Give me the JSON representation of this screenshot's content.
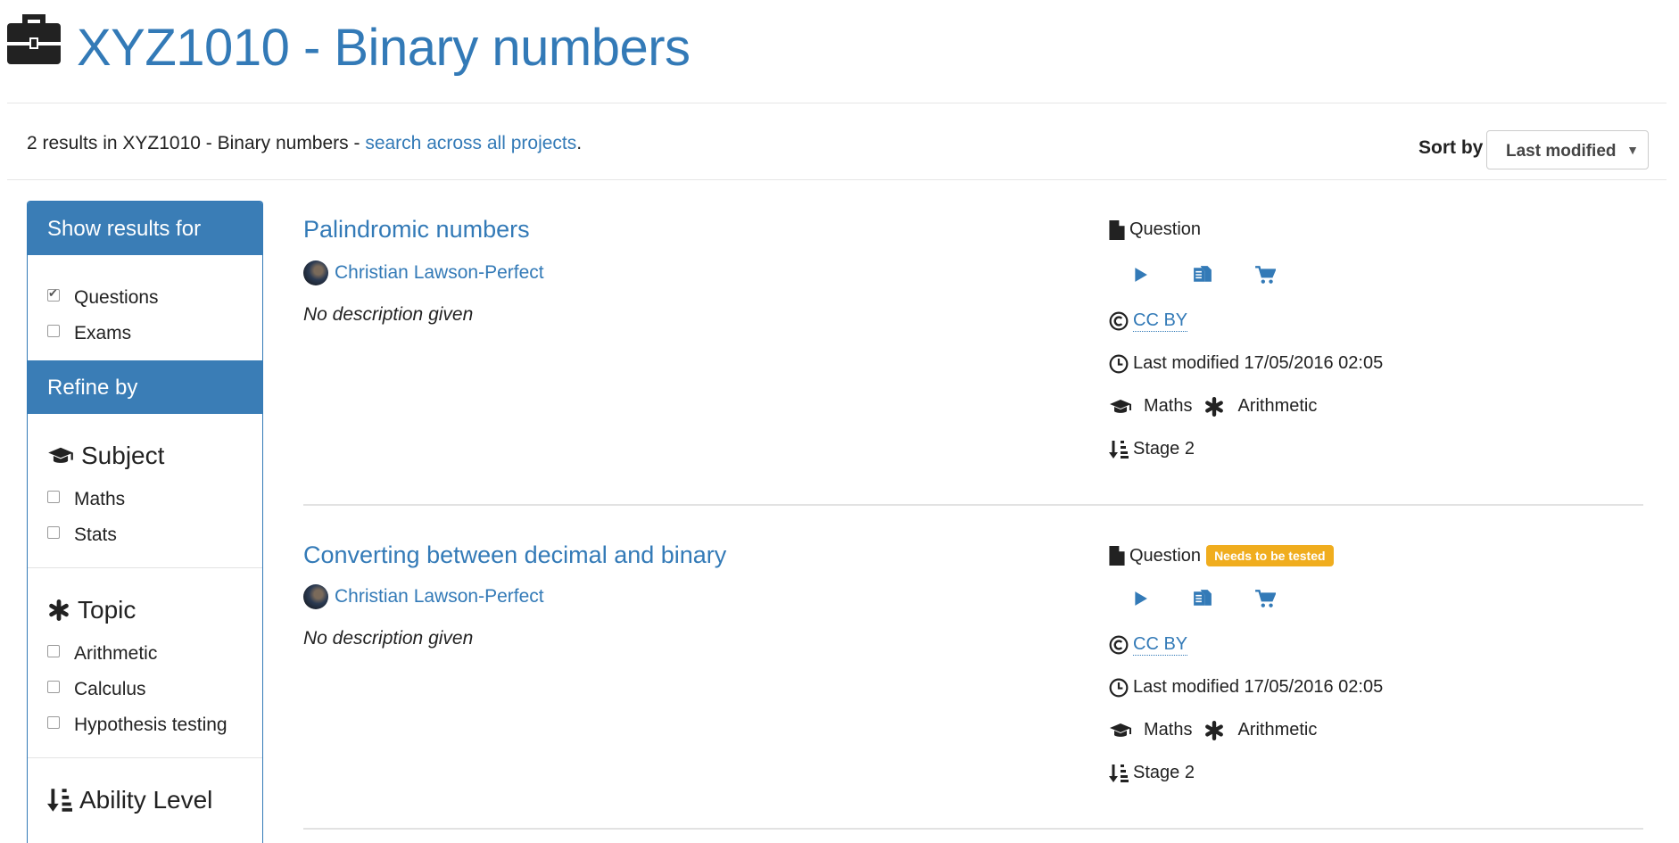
{
  "header": {
    "title": "XYZ1010 - Binary numbers",
    "icon": "briefcase-icon"
  },
  "results": {
    "summary_prefix": "2 results in XYZ1010 - Binary numbers - ",
    "search_all_link": "search across all projects",
    "suffix": "."
  },
  "sort": {
    "label": "Sort by",
    "selected": "Last modified"
  },
  "sidebar": {
    "show_results_heading": "Show results for",
    "types": [
      {
        "label": "Questions",
        "checked": true
      },
      {
        "label": "Exams",
        "checked": false
      }
    ],
    "refine_heading": "Refine by",
    "facets": [
      {
        "title": "Subject",
        "icon": "graduation-cap-icon",
        "options": [
          "Maths",
          "Stats"
        ]
      },
      {
        "title": "Topic",
        "icon": "asterisk-icon",
        "options": [
          "Arithmetic",
          "Calculus",
          "Hypothesis testing"
        ]
      },
      {
        "title": "Ability Level",
        "icon": "sort-ability-icon",
        "options": []
      }
    ]
  },
  "items": [
    {
      "title": "Palindromic numbers",
      "author": "Christian Lawson-Perfect",
      "description": "No description given",
      "type": "Question",
      "badge": "",
      "license": "CC BY",
      "last_modified": "Last modified 17/05/2016 02:05",
      "subject": "Maths",
      "topic": "Arithmetic",
      "ability": "Stage 2"
    },
    {
      "title": "Converting between decimal and binary",
      "author": "Christian Lawson-Perfect",
      "description": "No description given",
      "type": "Question",
      "badge": "Needs to be tested",
      "license": "CC BY",
      "last_modified": "Last modified 17/05/2016 02:05",
      "subject": "Maths",
      "topic": "Arithmetic",
      "ability": "Stage 2"
    }
  ],
  "colors": {
    "link": "#337ab7",
    "panel_heading": "#3a7db6",
    "badge": "#f0ad1e"
  }
}
